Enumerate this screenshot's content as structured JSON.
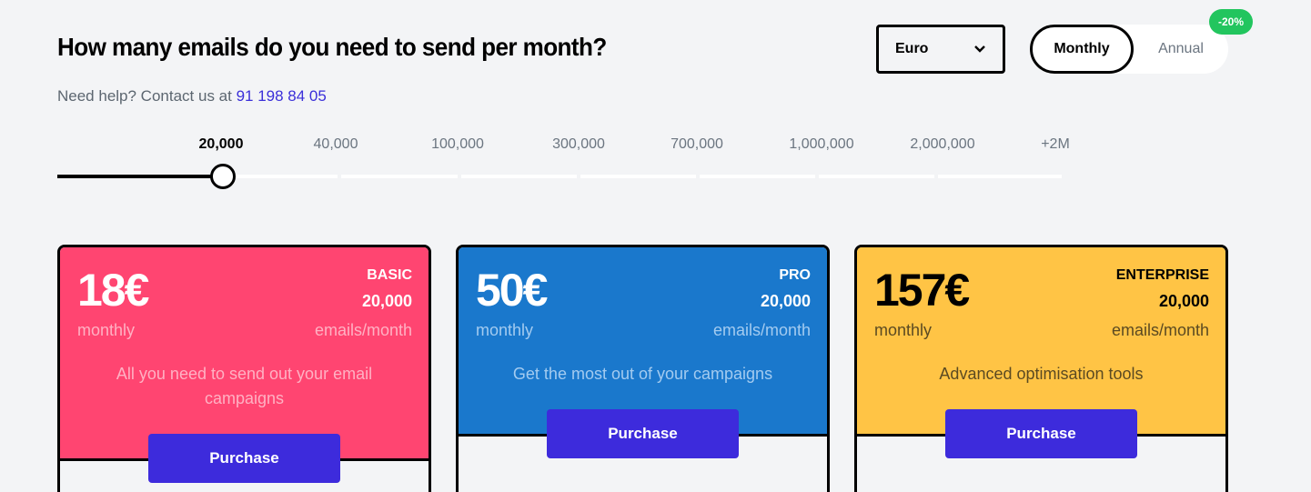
{
  "header": {
    "title": "How many emails do you need to send per month?",
    "help_prefix": "Need help? Contact us at ",
    "help_phone": "91 198 84 05"
  },
  "currency_select": {
    "value": "Euro"
  },
  "billing_toggle": {
    "options": [
      "Monthly",
      "Annual"
    ],
    "selected": "Monthly",
    "discount_badge": "-20%"
  },
  "volume_slider": {
    "ticks": [
      "20,000",
      "40,000",
      "100,000",
      "300,000",
      "700,000",
      "1,000,000",
      "2,000,000",
      "+2M"
    ],
    "selected_index": 0,
    "selected_value": "20,000"
  },
  "plans": [
    {
      "price": "18€",
      "name": "BASIC",
      "emails": "20,000",
      "period": "monthly",
      "units": "emails/month",
      "description": "All you need to send out your email campaigns",
      "button": "Purchase",
      "color": "#ff4571"
    },
    {
      "price": "50€",
      "name": "PRO",
      "emails": "20,000",
      "period": "monthly",
      "units": "emails/month",
      "description": "Get the most out of your campaigns",
      "button": "Purchase",
      "color": "#1a78cc"
    },
    {
      "price": "157€",
      "name": "ENTERPRISE",
      "emails": "20,000",
      "period": "monthly",
      "units": "emails/month",
      "description": "Advanced optimisation tools",
      "button": "Purchase",
      "color": "#ffc445"
    }
  ],
  "colors": {
    "accent": "#3d2bdc",
    "badge": "#22c55e",
    "background": "#f3f4f6"
  }
}
